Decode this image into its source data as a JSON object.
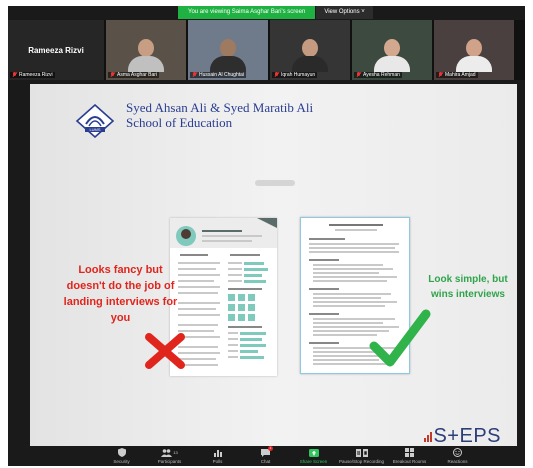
{
  "banner": {
    "share_text": "You are viewing Saima Asghar Bari's screen",
    "view_options": "View Options ˅"
  },
  "participants": [
    {
      "name": "Rameeza Rizvi",
      "video": false
    },
    {
      "name": "Asma Asghar Bari",
      "video": true,
      "shirt": "#c0c0c0",
      "skin": "#c79d84",
      "bg": "#5a5248"
    },
    {
      "name": "Hussain Al Chughtai",
      "video": true,
      "shirt": "#2e2e2e",
      "skin": "#9e7a60",
      "bg": "#6f7a8a"
    },
    {
      "name": "Iqrah Humayun",
      "video": true,
      "shirt": "#2a2a2a",
      "skin": "#c49a80",
      "bg": "#353535"
    },
    {
      "name": "Ayesha Rehman",
      "video": true,
      "shirt": "#e8e8e8",
      "skin": "#d2a88e",
      "bg": "#3d4a3f"
    },
    {
      "name": "Mahira Amjad",
      "video": true,
      "shirt": "#ececec",
      "skin": "#cfa289",
      "bg": "#4a4040"
    }
  ],
  "slide": {
    "school_line1": "Syed Ahsan Ali & Syed Maratib Ali",
    "school_line2": "School of Education",
    "logo_text": "LUMS",
    "left_caption": "Looks fancy but doesn't do the job of landing interviews for you",
    "right_caption": "Look simple, but wins interviews",
    "steps_logo": "S+EPS",
    "colors": {
      "title": "#2a3d8f",
      "reject": "#e0251c",
      "accept": "#2fa44a",
      "resume_accent": "#7fc9bd"
    }
  },
  "toolbar": [
    {
      "label": "Security",
      "icon": "shield-icon"
    },
    {
      "label": "Participants",
      "icon": "participants-icon",
      "count": "13"
    },
    {
      "label": "Polls",
      "icon": "polls-icon"
    },
    {
      "label": "Chat",
      "icon": "chat-icon",
      "badge": "1"
    },
    {
      "label": "Share Screen",
      "icon": "share-screen-icon"
    },
    {
      "label": "Pause/Stop Recording",
      "icon": "recording-icon"
    },
    {
      "label": "Breakout Rooms",
      "icon": "breakout-rooms-icon"
    },
    {
      "label": "Reactions",
      "icon": "reactions-icon"
    }
  ]
}
